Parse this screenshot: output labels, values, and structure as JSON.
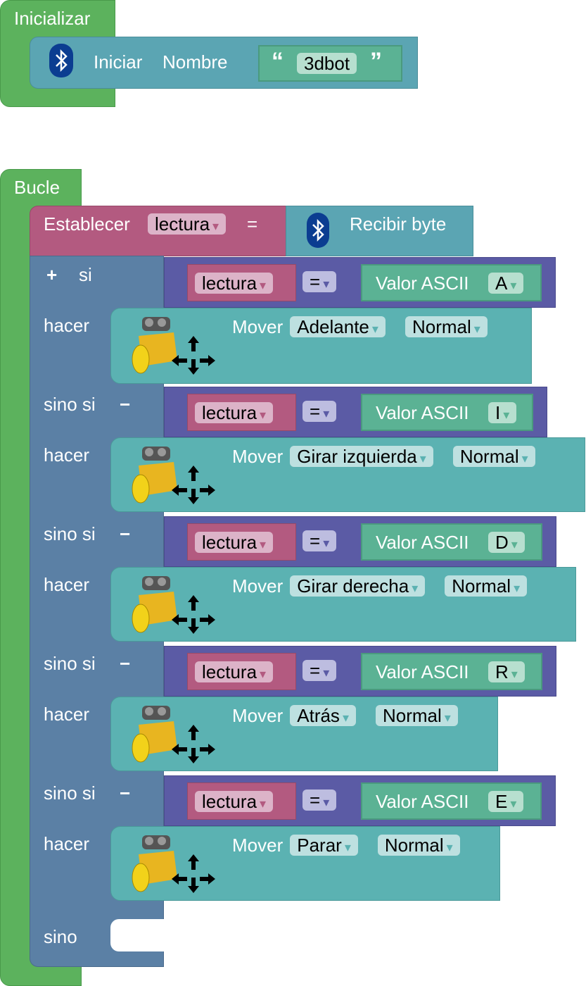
{
  "colors": {
    "event": "#5cb25d",
    "bluetooth": "#5ba5b3",
    "variable": "#b35a80",
    "control": "#5b80a5",
    "logic": "#5b5ba5",
    "motor": "#5bb2b2",
    "text": "#5bb294"
  },
  "init": {
    "title": "Inicializar",
    "block": {
      "icon": "bluetooth-icon",
      "label1": "Iniciar",
      "label2": "Nombre",
      "open_quote": "“",
      "value": "3dbot",
      "close_quote": "”"
    }
  },
  "loop": {
    "title": "Bucle",
    "set": {
      "label": "Establecer",
      "variable": "lectura",
      "arrow": "▾",
      "equals": "=",
      "recv_icon": "bluetooth-icon",
      "recv_label": "Recibir byte"
    },
    "if": {
      "plus": "+",
      "minus": "−",
      "if_label": "si",
      "elseif_label": "sino si",
      "do_label": "hacer",
      "else_label": "sino",
      "rows": [
        {
          "var": "lectura",
          "op": "=",
          "ascii_label": "Valor ASCII",
          "letter": "A",
          "move_label": "Mover",
          "direction": "Adelante",
          "speed": "Normal"
        },
        {
          "var": "lectura",
          "op": "=",
          "ascii_label": "Valor ASCII",
          "letter": "I",
          "move_label": "Mover",
          "direction": "Girar izquierda",
          "speed": "Normal"
        },
        {
          "var": "lectura",
          "op": "=",
          "ascii_label": "Valor ASCII",
          "letter": "D",
          "move_label": "Mover",
          "direction": "Girar derecha",
          "speed": "Normal"
        },
        {
          "var": "lectura",
          "op": "=",
          "ascii_label": "Valor ASCII",
          "letter": "R",
          "move_label": "Mover",
          "direction": "Atrás",
          "speed": "Normal"
        },
        {
          "var": "lectura",
          "op": "=",
          "ascii_label": "Valor ASCII",
          "letter": "E",
          "move_label": "Mover",
          "direction": "Parar",
          "speed": "Normal"
        }
      ]
    }
  }
}
